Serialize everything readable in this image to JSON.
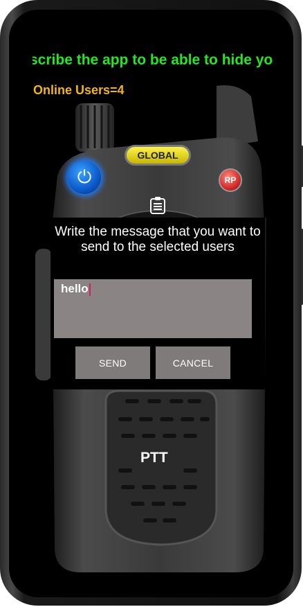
{
  "marquee": {
    "text": "scribe the app to be able to hide yo"
  },
  "status": {
    "online_users": "Online Users=4"
  },
  "radio": {
    "channel_label": "GLOBAL",
    "rp_label": "RP",
    "ptt_label": "PTT"
  },
  "dialog": {
    "title": "Write the message that you want to send to the selected users",
    "message_value": "hello",
    "send_label": "SEND",
    "cancel_label": "CANCEL"
  },
  "colors": {
    "marquee": "#22e81f",
    "online": "#f2b51b",
    "dialog_bg": "#000000",
    "input_bg": "#8a8484",
    "button_bg": "#7f7b7b"
  }
}
